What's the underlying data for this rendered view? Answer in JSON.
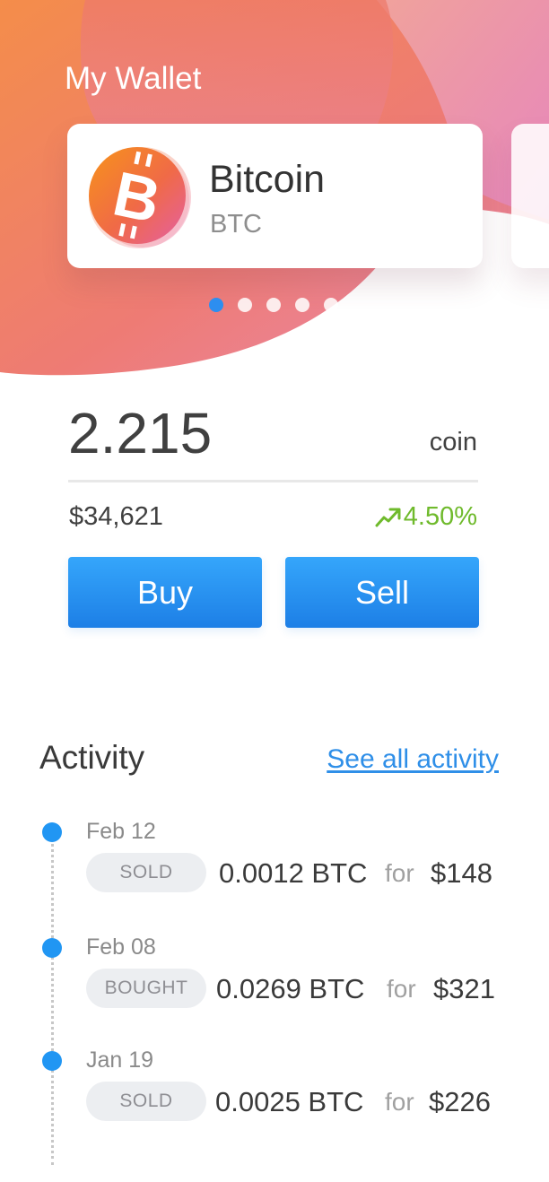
{
  "wallet": {
    "title": "My Wallet",
    "card": {
      "name": "Bitcoin",
      "symbol": "BTC",
      "icon": "bitcoin-icon"
    },
    "carousel": {
      "total": 5,
      "active": 1
    }
  },
  "balance": {
    "amount": "2.215",
    "unit": "coin",
    "fiat": "$34,621",
    "change": "4.50%",
    "change_icon": "trend-up-icon"
  },
  "actions": {
    "buy_label": "Buy",
    "sell_label": "Sell"
  },
  "activity": {
    "title": "Activity",
    "see_all": "See all activity",
    "items": [
      {
        "date": "Feb 12",
        "type": "SOLD",
        "amount": "0.0012 BTC",
        "for": "for",
        "price": "$148"
      },
      {
        "date": "Feb 08",
        "type": "BOUGHT",
        "amount": "0.0269 BTC",
        "for": "for",
        "price": "$321"
      },
      {
        "date": "Jan 19",
        "type": "SOLD",
        "amount": "0.0025 BTC",
        "for": "for",
        "price": "$226"
      }
    ]
  },
  "colors": {
    "accent": "#2196f3",
    "positive": "#6fba2c",
    "gradient_orange": "#f38a4e",
    "gradient_pink": "#e87fa8"
  }
}
